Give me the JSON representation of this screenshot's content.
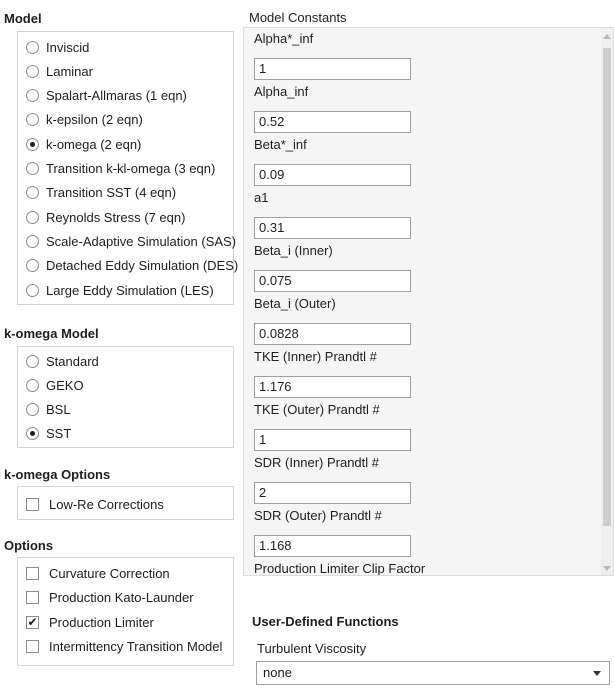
{
  "model": {
    "title": "Model",
    "options": [
      {
        "label": "Inviscid",
        "checked": false
      },
      {
        "label": "Laminar",
        "checked": false
      },
      {
        "label": "Spalart-Allmaras (1 eqn)",
        "checked": false
      },
      {
        "label": "k-epsilon (2 eqn)",
        "checked": false
      },
      {
        "label": "k-omega (2 eqn)",
        "checked": true
      },
      {
        "label": "Transition k-kl-omega (3 eqn)",
        "checked": false
      },
      {
        "label": "Transition SST (4 eqn)",
        "checked": false
      },
      {
        "label": "Reynolds Stress (7 eqn)",
        "checked": false
      },
      {
        "label": "Scale-Adaptive Simulation (SAS)",
        "checked": false
      },
      {
        "label": "Detached Eddy Simulation (DES)",
        "checked": false
      },
      {
        "label": "Large Eddy Simulation (LES)",
        "checked": false
      }
    ]
  },
  "komega_model": {
    "title": "k-omega Model",
    "options": [
      {
        "label": "Standard",
        "checked": false
      },
      {
        "label": "GEKO",
        "checked": false
      },
      {
        "label": "BSL",
        "checked": false
      },
      {
        "label": "SST",
        "checked": true
      }
    ]
  },
  "komega_options": {
    "title": "k-omega Options",
    "items": [
      {
        "label": "Low-Re Corrections",
        "checked": false
      }
    ]
  },
  "options": {
    "title": "Options",
    "items": [
      {
        "label": "Curvature Correction",
        "checked": false
      },
      {
        "label": "Production Kato-Launder",
        "checked": false
      },
      {
        "label": "Production Limiter",
        "checked": true
      },
      {
        "label": "Intermittency Transition Model",
        "checked": false
      }
    ]
  },
  "constants": {
    "title": "Model Constants",
    "items": [
      {
        "label": "Alpha*_inf",
        "value": "1"
      },
      {
        "label": "Alpha_inf",
        "value": "0.52"
      },
      {
        "label": "Beta*_inf",
        "value": "0.09"
      },
      {
        "label": "a1",
        "value": "0.31"
      },
      {
        "label": "Beta_i (Inner)",
        "value": "0.075"
      },
      {
        "label": "Beta_i (Outer)",
        "value": "0.0828"
      },
      {
        "label": "TKE (Inner) Prandtl #",
        "value": "1.176"
      },
      {
        "label": "TKE (Outer) Prandtl #",
        "value": "1"
      },
      {
        "label": "SDR (Inner) Prandtl #",
        "value": "2"
      },
      {
        "label": "SDR (Outer) Prandtl #",
        "value": "1.168"
      },
      {
        "label": "Production Limiter Clip Factor",
        "value": ""
      }
    ]
  },
  "udf": {
    "title": "User-Defined Functions",
    "turbulent_viscosity_label": "Turbulent Viscosity",
    "turbulent_viscosity_value": "none"
  }
}
